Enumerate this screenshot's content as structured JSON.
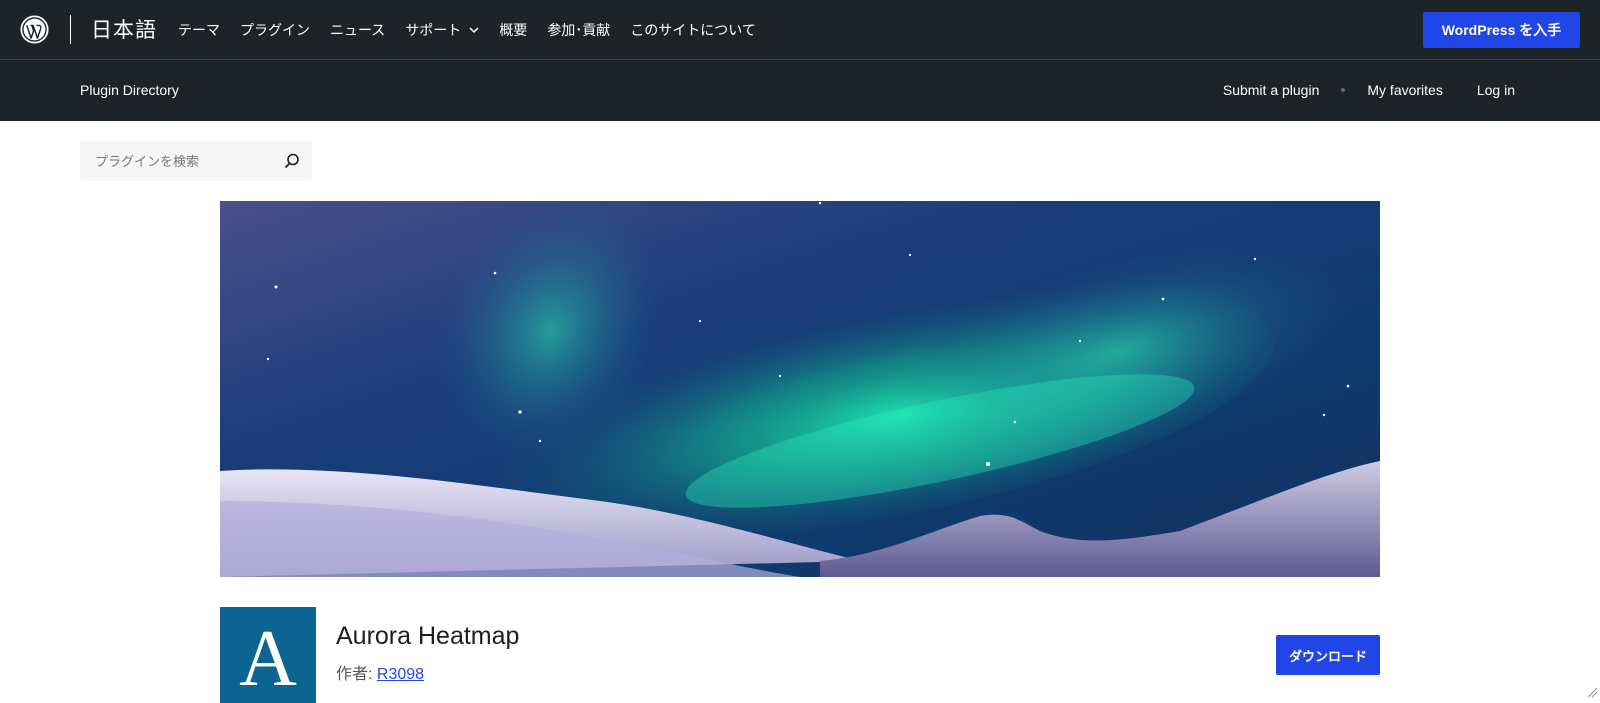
{
  "global_header": {
    "logo_icon": "wordpress-logo-icon",
    "locale_name": "日本語",
    "nav": [
      {
        "label": "テーマ"
      },
      {
        "label": "プラグイン"
      },
      {
        "label": "ニュース"
      },
      {
        "label": "サポート",
        "has_dropdown": true
      },
      {
        "label": "概要"
      },
      {
        "label": "参加･貢献"
      },
      {
        "label": "このサイトについて"
      }
    ],
    "get_wordpress_label": "WordPress を入手"
  },
  "local_nav": {
    "title": "Plugin Directory",
    "links": [
      {
        "label": "Submit a plugin"
      },
      {
        "label": "My favorites"
      },
      {
        "label": "Log in"
      }
    ]
  },
  "search": {
    "placeholder": "プラグインを検索",
    "value": "",
    "icon": "search-icon"
  },
  "banner": {
    "icon": "aurora-landscape-image"
  },
  "plugin": {
    "icon_letter": "A",
    "name": "Aurora Heatmap",
    "byline_prefix": "作者: ",
    "author": "R3098",
    "download_label": "ダウンロード"
  },
  "colors": {
    "header_bg": "#1e2327",
    "accent_blue": "#2145e6",
    "plugin_icon_bg": "#0b6590"
  }
}
